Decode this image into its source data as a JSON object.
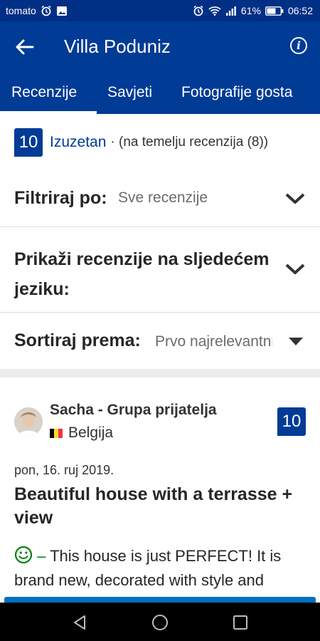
{
  "status_bar": {
    "carrier": "tomato",
    "battery": "61%",
    "time": "06:52"
  },
  "app_bar": {
    "title": "Villa Poduniz",
    "back_icon": "arrow-left-icon",
    "info_icon": "info-icon"
  },
  "tabs": [
    {
      "label": "Recenzije",
      "active": true
    },
    {
      "label": "Savjeti",
      "active": false
    },
    {
      "label": "Fotografije gosta",
      "active": false
    }
  ],
  "score": {
    "value": "10",
    "word": "Izuzetan",
    "subtitle": "· (na temelju recenzija (8))"
  },
  "filters": {
    "filter_by": {
      "label": "Filtriraj po:",
      "value": "Sve recenzije"
    },
    "language": {
      "label_line1": "Prikaži recenzije na sljedećem",
      "label_line2": "jeziku:"
    },
    "sort": {
      "label": "Sortiraj prema:",
      "value": "Prvo najrelevantnije"
    }
  },
  "review": {
    "reviewer": "Sacha - Grupa prijatelja",
    "country": "Belgija",
    "score": "10",
    "date": "pon, 16. ruj 2019.",
    "title": "Beautiful house with a terrasse + view",
    "dash": "–",
    "text": "This house is just PERFECT! It is brand new, decorated with style and"
  },
  "colors": {
    "brand_blue": "#003b95",
    "status_bar": "#002f86",
    "positive_green": "#008009",
    "button_blue": "#0071c2"
  }
}
